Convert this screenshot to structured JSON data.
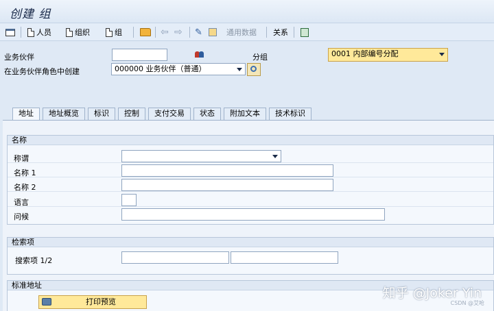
{
  "window": {
    "title": "创建 组"
  },
  "toolbar": {
    "person": "人员",
    "organization": "组织",
    "group": "组",
    "general_data": "通用数据",
    "relations": "关系"
  },
  "header": {
    "bp_label": "业务伙伴",
    "bp_value": "",
    "grouping_label": "分组",
    "grouping_value": "0001 内部编号分配",
    "role_label": "在业务伙伴角色中创建",
    "role_value": "000000 业务伙伴（普通）"
  },
  "tabs": [
    "地址",
    "地址概览",
    "标识",
    "控制",
    "支付交易",
    "状态",
    "附加文本",
    "技术标识"
  ],
  "name_section": {
    "title": "名称",
    "title_label": "称谓",
    "name1_label": "名称 1",
    "name2_label": "名称 2",
    "language_label": "语言",
    "greeting_label": "问候"
  },
  "search_section": {
    "title": "检索项",
    "search_label": "搜索项 1/2"
  },
  "address_section": {
    "title": "标准地址",
    "print_button": "打印预览"
  },
  "watermark": {
    "text": "知乎 @Joker Yin",
    "sub": "CSDN @艾呛"
  }
}
